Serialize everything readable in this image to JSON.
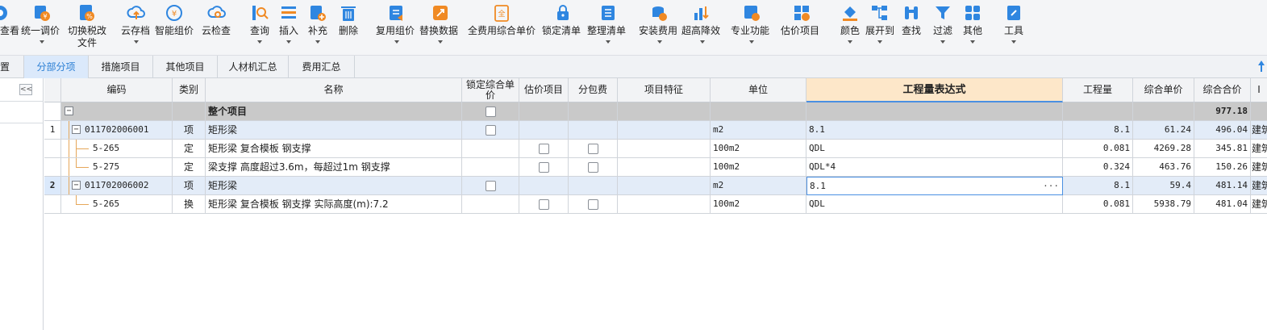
{
  "toolbar": {
    "items": [
      {
        "label": "查看",
        "icon": "view-icon"
      },
      {
        "label": "统一调价",
        "icon": "adjust-price-icon"
      },
      {
        "label": "切换税改",
        "label2": "文件",
        "icon": "tax-switch-icon"
      },
      {
        "label": "云存档",
        "icon": "cloud-archive-icon"
      },
      {
        "label": "智能组价",
        "icon": "smart-pricing-icon"
      },
      {
        "label": "云检查",
        "icon": "cloud-check-icon"
      },
      {
        "label": "查询",
        "icon": "query-icon"
      },
      {
        "label": "插入",
        "icon": "insert-icon"
      },
      {
        "label": "补充",
        "icon": "supplement-icon"
      },
      {
        "label": "删除",
        "icon": "delete-icon"
      },
      {
        "label": "复用组价",
        "icon": "reuse-pricing-icon"
      },
      {
        "label": "替换数据",
        "icon": "replace-data-icon"
      },
      {
        "label": "全费用综合单价",
        "icon": "full-cost-icon"
      },
      {
        "label": "锁定清单",
        "icon": "lock-list-icon"
      },
      {
        "label": "整理清单",
        "icon": "organize-list-icon"
      },
      {
        "label": "安装费用",
        "icon": "install-cost-icon"
      },
      {
        "label": "超高降效",
        "icon": "height-efficiency-icon"
      },
      {
        "label": "专业功能",
        "icon": "professional-icon"
      },
      {
        "label": "估价项目",
        "icon": "estimate-icon"
      },
      {
        "label": "颜色",
        "icon": "color-icon"
      },
      {
        "label": "展开到",
        "icon": "expand-to-icon"
      },
      {
        "label": "查找",
        "icon": "find-icon"
      },
      {
        "label": "过滤",
        "icon": "filter-icon"
      },
      {
        "label": "其他",
        "icon": "other-icon"
      },
      {
        "label": "工具",
        "icon": "tools-icon"
      }
    ]
  },
  "tabs": [
    {
      "label": "置"
    },
    {
      "label": "分部分项"
    },
    {
      "label": "措施项目"
    },
    {
      "label": "其他项目"
    },
    {
      "label": "人材机汇总"
    },
    {
      "label": "费用汇总"
    }
  ],
  "grid": {
    "columns": [
      "编码",
      "类别",
      "名称",
      "锁定综合单价",
      "估价项目",
      "分包费",
      "项目特征",
      "单位",
      "工程量表达式",
      "工程量",
      "综合单价",
      "综合合价",
      "I"
    ],
    "total_row": {
      "name": "整个项目",
      "total": "977.18"
    },
    "rows": [
      {
        "rownum": "1",
        "code": "011702006001",
        "type": "项",
        "name": "矩形梁",
        "unit": "m2",
        "expr": "8.1",
        "qty": "8.1",
        "unit_price": "61.24",
        "total": "496.04",
        "extra": "建筑"
      },
      {
        "rownum": "",
        "code": "5-265",
        "type": "定",
        "name": "矩形梁 复合模板 钢支撑",
        "unit": "100m2",
        "expr": "QDL",
        "qty": "0.081",
        "unit_price": "4269.28",
        "total": "345.81",
        "extra": "建筑"
      },
      {
        "rownum": "",
        "code": "5-275",
        "type": "定",
        "name": "梁支撑 高度超过3.6m，每超过1m 钢支撑",
        "unit": "100m2",
        "expr": "QDL*4",
        "qty": "0.324",
        "unit_price": "463.76",
        "total": "150.26",
        "extra": "建筑"
      },
      {
        "rownum": "2",
        "code": "011702006002",
        "type": "项",
        "name": "矩形梁",
        "unit": "m2",
        "expr": "8.1",
        "qty": "8.1",
        "unit_price": "59.4",
        "total": "481.14",
        "extra": "建筑"
      },
      {
        "rownum": "",
        "code": "5-265",
        "type": "换",
        "name": "矩形梁 复合模板 钢支撑  实际高度(m):7.2",
        "unit": "100m2",
        "expr": "QDL",
        "qty": "0.081",
        "unit_price": "5938.79",
        "total": "481.04",
        "extra": "建筑"
      }
    ],
    "edit_dots": "···"
  },
  "left_panel": {
    "collapse": "<<"
  },
  "colors": {
    "accent": "#4a90e2",
    "tab_active_text": "#2b7fd4",
    "header_highlight": "#fde7c9",
    "total_row": "#c9c9c9",
    "item_row": "#e3ecf8"
  }
}
